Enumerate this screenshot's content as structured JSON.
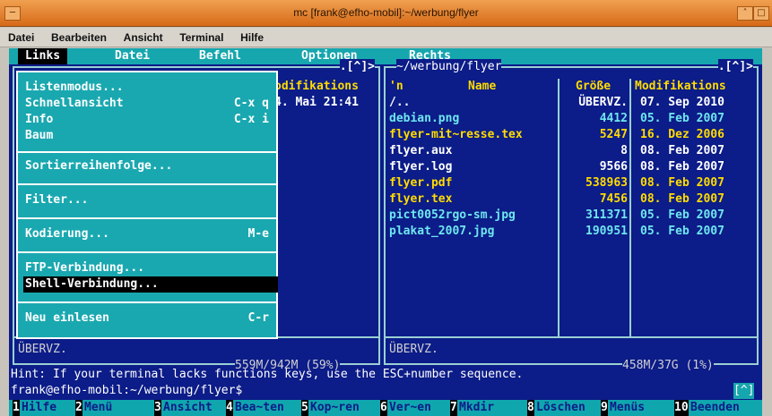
{
  "window": {
    "title": "mc [frank@efho-mobil]:~/werbung/flyer",
    "menu": [
      "Datei",
      "Bearbeiten",
      "Ansicht",
      "Terminal",
      "Hilfe"
    ],
    "controls": [
      "─",
      "˄",
      "□"
    ]
  },
  "mc_menubar": {
    "items": [
      "Links",
      "Datei",
      "Befehl",
      "Optionen",
      "Rechts"
    ],
    "selected": "Links"
  },
  "dropdown": {
    "items": [
      {
        "label": "Listenmodus...",
        "key": ""
      },
      {
        "label": "Schnellansicht",
        "key": "C-x q"
      },
      {
        "label": "Info",
        "key": "C-x i"
      },
      {
        "label": "Baum",
        "key": ""
      },
      {
        "label": "Sortierreihenfolge...",
        "key": ""
      },
      {
        "label": "Filter...",
        "key": ""
      },
      {
        "label": "Kodierung...",
        "key": "M-e"
      },
      {
        "label": "FTP-Verbindung...",
        "key": ""
      },
      {
        "label": "Shell-Verbindung...",
        "key": ""
      },
      {
        "label": "Neu einlesen",
        "key": "C-r"
      }
    ],
    "active": "Shell-Verbindung..."
  },
  "left_panel": {
    "header_modified": "odifikations",
    "indicator": ".[^]>",
    "row_modified": "4. Mai 21:41",
    "mini_status": "ÜBERVZ.",
    "disk": "559M/942M (59%)"
  },
  "right_panel": {
    "path": "~/werbung/flyer",
    "indicator": ".[^]>",
    "columns": [
      "'n",
      "Name",
      "Größe",
      "Modifikations"
    ],
    "files": [
      {
        "name": "/..",
        "size": "ÜBERVZ.",
        "date": "07. Sep 2010",
        "color": "white"
      },
      {
        "name": "debian.png",
        "size": "4412",
        "date": "05. Feb 2007",
        "color": "cyan"
      },
      {
        "name": "flyer-mit~resse.tex",
        "size": "5247",
        "date": "16. Dez 2006",
        "color": "yellow"
      },
      {
        "name": "flyer.aux",
        "size": "8",
        "date": "08. Feb 2007",
        "color": "white"
      },
      {
        "name": "flyer.log",
        "size": "9566",
        "date": "08. Feb 2007",
        "color": "white"
      },
      {
        "name": "flyer.pdf",
        "size": "538963",
        "date": "08. Feb 2007",
        "color": "yellow"
      },
      {
        "name": "flyer.tex",
        "size": "7456",
        "date": "08. Feb 2007",
        "color": "yellow"
      },
      {
        "name": "pict0052rgo-sm.jpg",
        "size": "311371",
        "date": "05. Feb 2007",
        "color": "cyan"
      },
      {
        "name": "plakat_2007.jpg",
        "size": "190951",
        "date": "05. Feb 2007",
        "color": "cyan"
      }
    ],
    "mini_status": "ÜBERVZ.",
    "disk": "458M/37G (1%)"
  },
  "hint": "Hint: If your terminal lacks functions keys, use the ESC+number sequence.",
  "prompt": "frank@efho-mobil:~/werbung/flyer$",
  "prompt_indicator": "[^]",
  "fkeys": [
    {
      "n": "1",
      "l": "Hilfe"
    },
    {
      "n": "2",
      "l": "Menü"
    },
    {
      "n": "3",
      "l": "Ansicht"
    },
    {
      "n": "4",
      "l": "Bea~ten"
    },
    {
      "n": "5",
      "l": "Kop~ren"
    },
    {
      "n": "6",
      "l": "Ver~en"
    },
    {
      "n": "7",
      "l": "Mkdir"
    },
    {
      "n": "8",
      "l": "Löschen"
    },
    {
      "n": "9",
      "l": "Menüs"
    },
    {
      "n": "10",
      "l": "Beenden"
    }
  ],
  "colors": {
    "terminal_bg": "#0c1c88",
    "menu_bg": "#16a6ae",
    "title_bg": "#e08030"
  }
}
